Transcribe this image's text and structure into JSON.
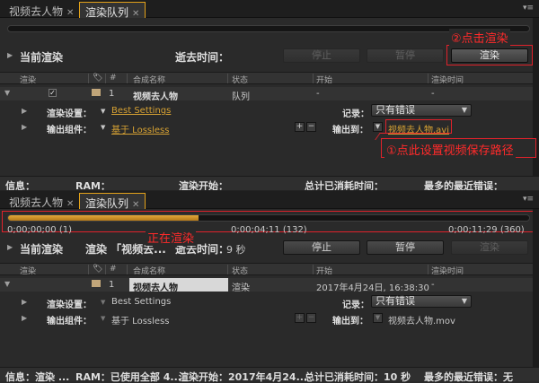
{
  "top": {
    "tabs": [
      {
        "label": "视频去人物",
        "active": false
      },
      {
        "label": "渲染队列",
        "active": true
      }
    ],
    "header": {
      "current_render": "当前渲染",
      "elapsed_label": "逝去时间：",
      "stop": "停止",
      "pause": "暂停",
      "render": "渲染"
    },
    "columns": [
      "渲染",
      "#",
      "合成名称",
      "状态",
      "开始",
      "渲染时间"
    ],
    "item": {
      "index": "1",
      "comp": "视频去人物",
      "status": "队列",
      "start": "-",
      "time": "-"
    },
    "render_settings_label": "渲染设置：",
    "render_settings_value": "Best Settings",
    "output_module_label": "输出组件：",
    "output_module_value": "基于 Lossless",
    "log_label": "记录：",
    "log_value": "只有错误",
    "output_to_label": "输出到：",
    "output_to_value": "视频去人物.avi",
    "footer": {
      "info": "信息：",
      "ram": "RAM：",
      "render_start": "渲染开始：",
      "total_time": "总计已消耗时间：",
      "recent_error": "最多的最近错误："
    }
  },
  "annotations": {
    "click_render": "②点击渲染",
    "set_path": "①点此设置视频保存路径",
    "rendering": "正在渲染"
  },
  "bottom": {
    "tabs": [
      {
        "label": "视频去人物",
        "active": false
      },
      {
        "label": "渲染队列",
        "active": true
      }
    ],
    "progress": {
      "fraction": 0.365,
      "time_start": "0;00;00;00 (1)",
      "time_mid": "0;00;04;11 (132)",
      "time_end": "0;00;11;29 (360)"
    },
    "header": {
      "current_render": "当前渲染",
      "render_prefix": "渲染 「视频去...",
      "elapsed_label": "逝去时间：",
      "elapsed_value": "9 秒",
      "stop": "停止",
      "pause": "暂停",
      "render": "渲染"
    },
    "columns": [
      "渲染",
      "#",
      "合成名称",
      "状态",
      "开始",
      "渲染时间"
    ],
    "item": {
      "index": "1",
      "comp": "视频去人物",
      "status": "渲染",
      "start": "2017年4月24日, 16:38:30",
      "time": "-"
    },
    "render_settings_label": "渲染设置：",
    "render_settings_value": "Best Settings",
    "output_module_label": "输出组件：",
    "output_module_value": "基于 Lossless",
    "log_label": "记录：",
    "log_value": "只有错误",
    "output_to_label": "输出到：",
    "output_to_value": "视频去人物.mov",
    "footer": {
      "info": "信息：渲染 ...",
      "ram": "RAM：已使用全部 4...",
      "render_start": "渲染开始：2017年4月24...",
      "total_time": "总计已消耗时间：10 秒",
      "recent_error": "最多的最近错误：无"
    }
  },
  "colors": {
    "accent": "#e2a11a",
    "annotation_red": "#e0222b",
    "link": "#d6a133"
  }
}
